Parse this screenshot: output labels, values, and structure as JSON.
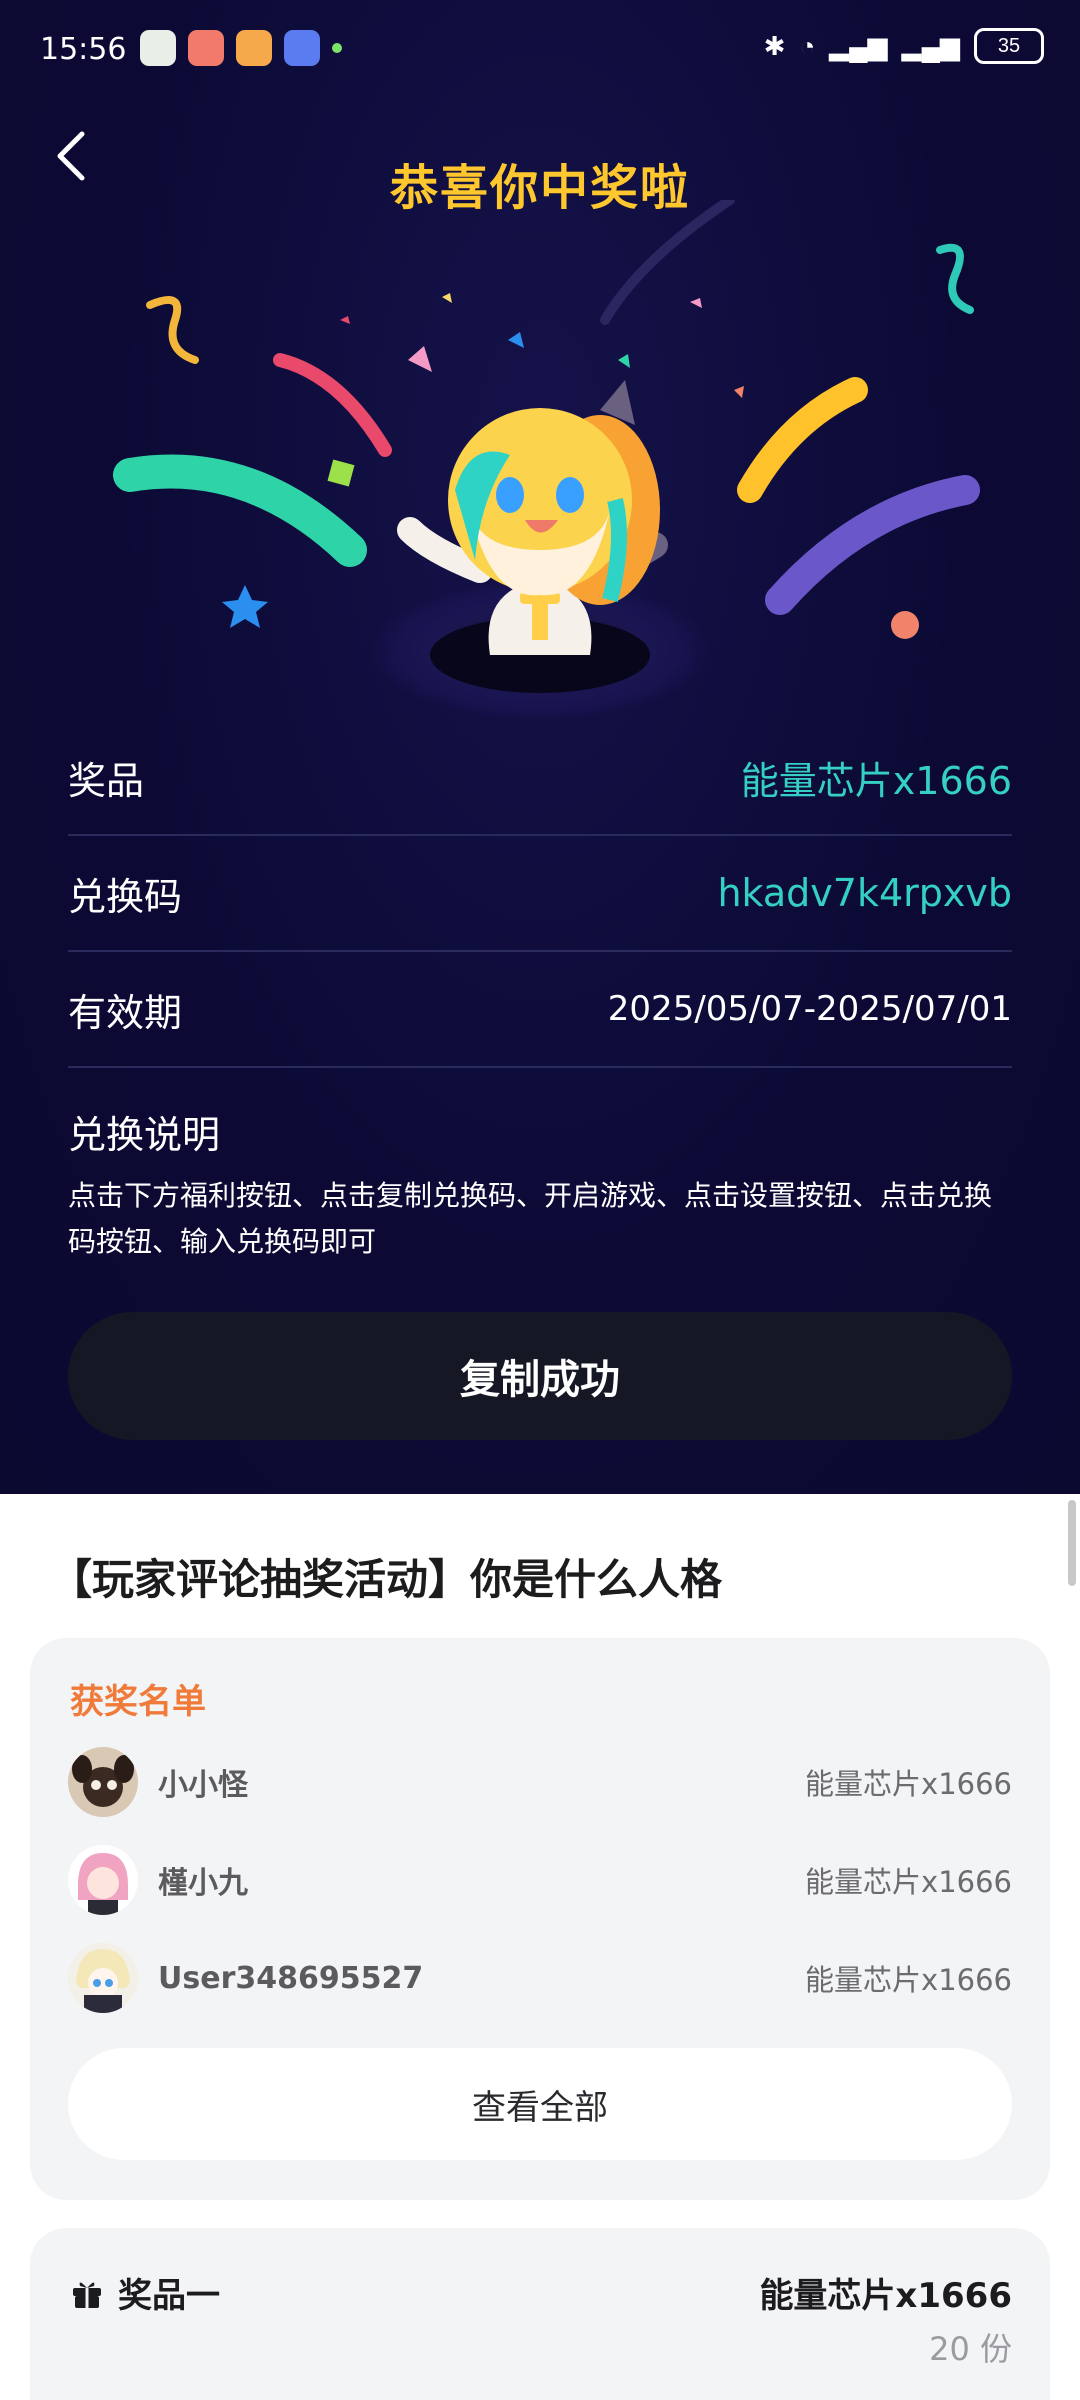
{
  "status_bar": {
    "time": "15:56",
    "battery": "35"
  },
  "banner": {
    "title": "恭喜你中奖啦"
  },
  "prize_info": {
    "prize_label": "奖品",
    "prize_value": "能量芯片x1666",
    "code_label": "兑换码",
    "code_value": "hkadv7k4rpxvb",
    "validity_label": "有效期",
    "validity_value": "2025/05/07-2025/07/01",
    "instructions_label": "兑换说明",
    "instructions_text": "点击下方福利按钮、点击复制兑换码、开启游戏、点击设置按钮、点击兑换码按钮、输入兑换码即可"
  },
  "copy_button": {
    "label": "复制成功"
  },
  "activity": {
    "title": "【玩家评论抽奖活动】你是什么人格"
  },
  "winners": {
    "title": "获奖名单",
    "list": [
      {
        "name": "小小怪",
        "prize": "能量芯片x1666"
      },
      {
        "name": "槿小九",
        "prize": "能量芯片x1666"
      },
      {
        "name": "User348695527",
        "prize": "能量芯片x1666"
      }
    ],
    "view_all_label": "查看全部"
  },
  "prize_tier": {
    "label": "奖品一",
    "name": "能量芯片x1666",
    "count": "20 份"
  },
  "colors": {
    "background": "#0c0a35",
    "title_gold": "#ffc72e",
    "teal_value": "#35d0c4",
    "winners_orange": "#f07a3a",
    "button_dark": "#151725"
  }
}
